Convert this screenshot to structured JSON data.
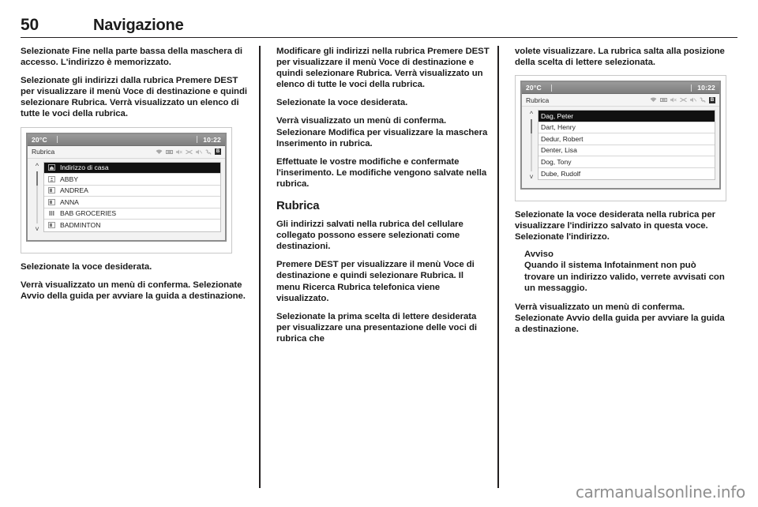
{
  "header": {
    "page_number": "50",
    "title": "Navigazione"
  },
  "watermark": "carmanualsonline.info",
  "columns": {
    "left": {
      "paragraphs": [
        "Selezionate Fine nella parte bassa della maschera di accesso. L'indirizzo è memorizzato.",
        "Selezionate gli indirizzi dalla rubrica Premere DEST per visualizzare il menù Voce di destinazione e quindi selezionare Rubrica. Verrà visualizzato un elenco di tutte le voci della rubrica."
      ],
      "after_image_paragraphs": [
        "Selezionate la voce desiderata.",
        "Verrà visualizzato un menù di conferma. Selezionate Avvio della guida per avviare la guida a destinazione."
      ]
    },
    "middle": {
      "paragraphs": [
        "Modificare gli indirizzi nella rubrica Premere DEST per visualizzare il menù Voce di destinazione e quindi selezionare Rubrica. Verrà visualizzato un elenco di tutte le voci della rubrica.",
        "Selezionate la voce desiderata.",
        "Verrà visualizzato un menù di conferma. Selezionare Modifica per visualizzare la maschera Inserimento in rubrica.",
        "Effettuate le vostre modifiche e confermate l'inserimento. Le modifiche vengono salvate nella rubrica."
      ],
      "section_title": "Rubrica",
      "section_paragraphs": [
        "Gli indirizzi salvati nella rubrica del cellulare collegato possono essere selezionati come destinazioni.",
        "Premere DEST per visualizzare il menù Voce di destinazione e quindi selezionare Rubrica. Il menu Ricerca Rubrica telefonica viene visualizzato.",
        "Selezionate la prima scelta di lettere desiderata per visualizzare una presentazione delle voci di rubrica che"
      ]
    },
    "right": {
      "paragraphs": [
        "volete visualizzare. La rubrica salta alla posizione della scelta di lettere selezionata."
      ],
      "after_image_paragraphs": [
        "Selezionate la voce desiderata nella rubrica per visualizzare l'indirizzo salvato in questa voce. Selezionate l'indirizzo."
      ],
      "note": {
        "title": "Avviso",
        "body": "Quando il sistema Infotainment non può trovare un indirizzo valido, verrete avvisati con un messaggio."
      },
      "final_paragraphs": [
        "Verrà visualizzato un menù di conferma. Selezionate Avvio della guida per avviare la guida a destinazione."
      ]
    }
  },
  "screenshots": [
    {
      "name": "rubrica-list-1",
      "status_bar": {
        "temperature": "20°C",
        "clock": "10:22"
      },
      "title": "Rubrica",
      "status_icons": [
        "wifi-icon",
        "phone-signal-icon",
        "mute-icon",
        "shuffle-icon",
        "speaker-off-icon",
        "call-icon",
        "bluetooth-icon"
      ],
      "rows": [
        {
          "icon": "home-icon",
          "label": "Indirizzo di casa",
          "selected": true
        },
        {
          "icon": "contact-icon",
          "label": "ABBY",
          "selected": false
        },
        {
          "icon": "contact-icon",
          "label": "ANDREA",
          "selected": false
        },
        {
          "icon": "contact-icon",
          "label": "ANNA",
          "selected": false
        },
        {
          "icon": "business-icon",
          "label": "BAB GROCERIES",
          "selected": false
        },
        {
          "icon": "contact-icon",
          "label": "BADMINTON",
          "selected": false
        }
      ]
    },
    {
      "name": "rubrica-list-2",
      "status_bar": {
        "temperature": "20°C",
        "clock": "10:22"
      },
      "title": "Rubrica",
      "status_icons": [
        "wifi-icon",
        "phone-signal-icon",
        "mute-icon",
        "shuffle-icon",
        "speaker-off-icon",
        "call-icon",
        "bluetooth-icon"
      ],
      "rows": [
        {
          "icon": "none",
          "label": "Dag, Peter",
          "selected": true
        },
        {
          "icon": "none",
          "label": "Dart, Henry",
          "selected": false
        },
        {
          "icon": "none",
          "label": "Dedur, Robert",
          "selected": false
        },
        {
          "icon": "none",
          "label": "Denter, Lisa",
          "selected": false
        },
        {
          "icon": "none",
          "label": "Dog, Tony",
          "selected": false
        },
        {
          "icon": "none",
          "label": "Dube, Rudolf",
          "selected": false
        }
      ]
    }
  ],
  "colors": {
    "text": "#1b1b1b",
    "rule": "#231f20",
    "selected_row_bg": "#111111",
    "watermark": "#8e8e8e"
  }
}
